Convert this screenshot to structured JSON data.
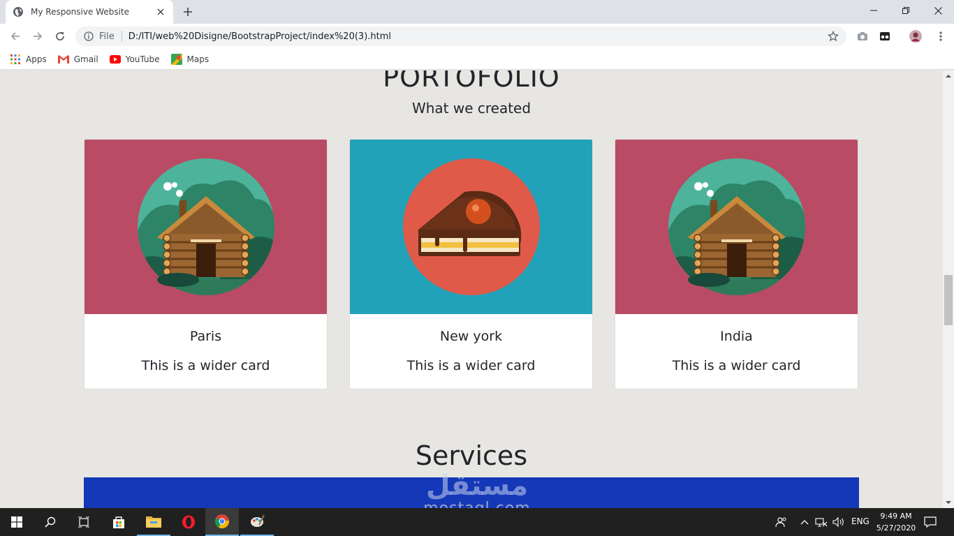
{
  "browser": {
    "tab_title": "My Responsive Website",
    "omnibox_scheme_label": "File",
    "url": "D:/ITI/web%20Disigne/BootstrapProject/index%20(3).html",
    "bookmarks": [
      {
        "label": "Apps",
        "icon": "apps-grid-icon"
      },
      {
        "label": "Gmail",
        "icon": "gmail-icon"
      },
      {
        "label": "YouTube",
        "icon": "youtube-icon"
      },
      {
        "label": "Maps",
        "icon": "maps-icon"
      }
    ]
  },
  "page": {
    "portfolio_title": "PORTOFOLIO",
    "portfolio_subtitle": "What we created",
    "cards": [
      {
        "title": "Paris",
        "text": "This is a wider card",
        "bg": "#b94b65",
        "image": "log-cabin-illustration"
      },
      {
        "title": "New york",
        "text": "This is a wider card",
        "bg": "#21a2b8",
        "image": "cake-slice-illustration"
      },
      {
        "title": "India",
        "text": "This is a wider card",
        "bg": "#b94b65",
        "image": "log-cabin-illustration"
      }
    ],
    "services_title": "Services",
    "services_bar_color": "#1438b8"
  },
  "watermark": {
    "arabic": "مستقل",
    "latin": "mostaql.com"
  },
  "taskbar": {
    "language": "ENG",
    "time": "9:49 AM",
    "date": "5/27/2020"
  }
}
